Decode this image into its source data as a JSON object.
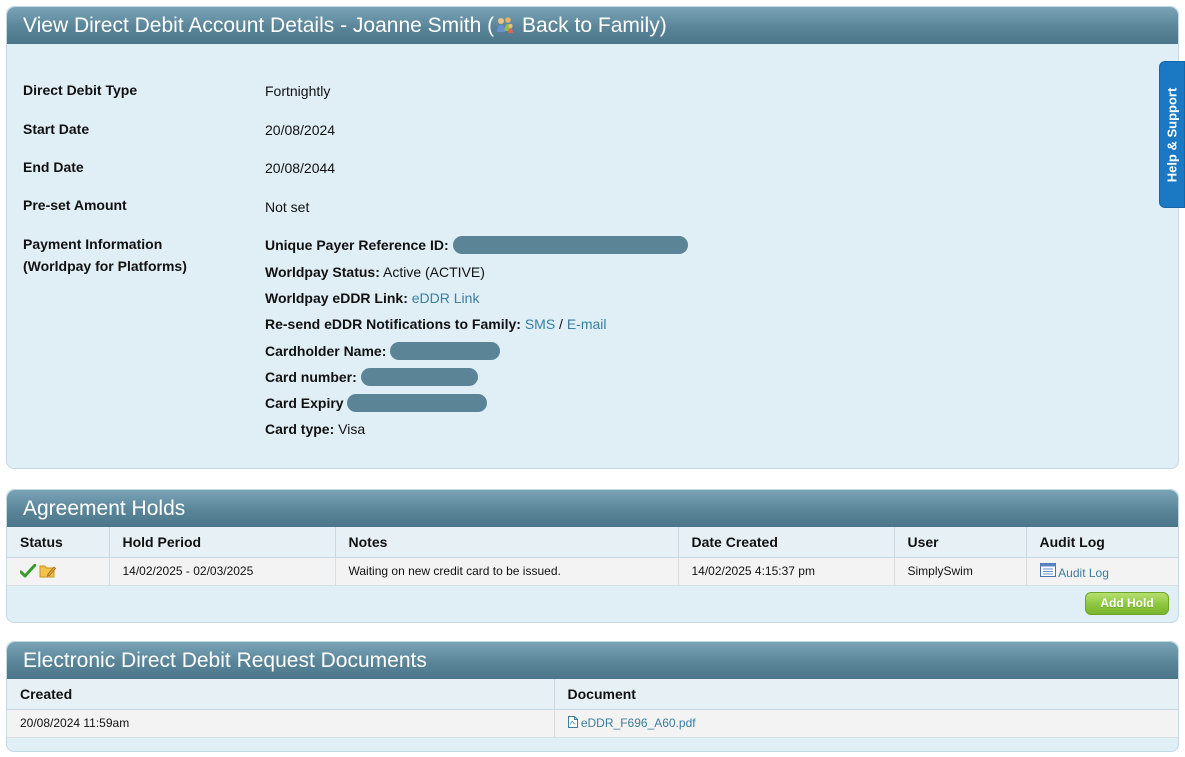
{
  "header": {
    "title_prefix": "View Direct Debit Account Details - Joanne Smith (",
    "back_link": "Back to Family",
    "title_suffix": ")"
  },
  "details": {
    "type_label": "Direct Debit Type",
    "type_value": "Fortnightly",
    "start_label": "Start Date",
    "start_value": "20/08/2024",
    "end_label": "End Date",
    "end_value": "20/08/2044",
    "preset_label": "Pre-set Amount",
    "preset_value": "Not set",
    "payment_label_1": "Payment Information",
    "payment_label_2": "(Worldpay for Platforms)",
    "upr_label": "Unique Payer Reference ID:",
    "status_label": "Worldpay Status:",
    "status_value": "Active (ACTIVE)",
    "eddr_label": "Worldpay eDDR Link:",
    "eddr_link": "eDDR Link",
    "resend_label": "Re-send eDDR Notifications to Family:",
    "sms_link": "SMS",
    "separator": "/",
    "email_link": "E-mail",
    "cardholder_label": "Cardholder Name:",
    "card_number_label": "Card number:",
    "card_expiry_label": "Card Expiry",
    "card_type_label": "Card type:",
    "card_type_value": "Visa"
  },
  "holds": {
    "title": "Agreement Holds",
    "columns": [
      "Status",
      "Hold Period",
      "Notes",
      "Date Created",
      "User",
      "Audit Log"
    ],
    "rows": [
      {
        "status_icons": [
          "check-icon",
          "edit-folder-icon"
        ],
        "period": "14/02/2025 - 02/03/2025",
        "notes": "Waiting on new credit card to be issued.",
        "date_created": "14/02/2025 4:15:37 pm",
        "user": "SimplySwim",
        "audit": "Audit Log"
      }
    ],
    "add_button": "Add Hold"
  },
  "docs": {
    "title": "Electronic Direct Debit Request Documents",
    "columns": [
      "Created",
      "Document"
    ],
    "rows": [
      {
        "created": "20/08/2024 11:59am",
        "document": "eDDR_F696_A60.pdf"
      }
    ]
  },
  "help_tab": "Help & Support",
  "colors": {
    "header_bar": "#5a8599",
    "panel_bg": "#e0eef6",
    "link": "#3a7ea0",
    "add_button": "#8cc63f",
    "help_tab": "#1b78c2"
  }
}
